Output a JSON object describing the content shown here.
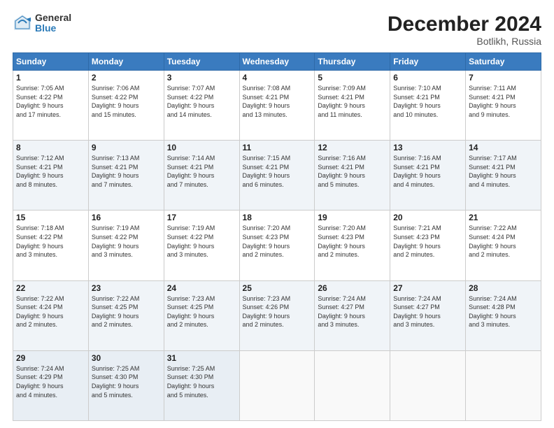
{
  "logo": {
    "line1": "General",
    "line2": "Blue"
  },
  "title": "December 2024",
  "subtitle": "Botlikh, Russia",
  "days_header": [
    "Sunday",
    "Monday",
    "Tuesday",
    "Wednesday",
    "Thursday",
    "Friday",
    "Saturday"
  ],
  "weeks": [
    [
      {
        "day": "1",
        "info": "Sunrise: 7:05 AM\nSunset: 4:22 PM\nDaylight: 9 hours\nand 17 minutes."
      },
      {
        "day": "2",
        "info": "Sunrise: 7:06 AM\nSunset: 4:22 PM\nDaylight: 9 hours\nand 15 minutes."
      },
      {
        "day": "3",
        "info": "Sunrise: 7:07 AM\nSunset: 4:22 PM\nDaylight: 9 hours\nand 14 minutes."
      },
      {
        "day": "4",
        "info": "Sunrise: 7:08 AM\nSunset: 4:21 PM\nDaylight: 9 hours\nand 13 minutes."
      },
      {
        "day": "5",
        "info": "Sunrise: 7:09 AM\nSunset: 4:21 PM\nDaylight: 9 hours\nand 11 minutes."
      },
      {
        "day": "6",
        "info": "Sunrise: 7:10 AM\nSunset: 4:21 PM\nDaylight: 9 hours\nand 10 minutes."
      },
      {
        "day": "7",
        "info": "Sunrise: 7:11 AM\nSunset: 4:21 PM\nDaylight: 9 hours\nand 9 minutes."
      }
    ],
    [
      {
        "day": "8",
        "info": "Sunrise: 7:12 AM\nSunset: 4:21 PM\nDaylight: 9 hours\nand 8 minutes."
      },
      {
        "day": "9",
        "info": "Sunrise: 7:13 AM\nSunset: 4:21 PM\nDaylight: 9 hours\nand 7 minutes."
      },
      {
        "day": "10",
        "info": "Sunrise: 7:14 AM\nSunset: 4:21 PM\nDaylight: 9 hours\nand 7 minutes."
      },
      {
        "day": "11",
        "info": "Sunrise: 7:15 AM\nSunset: 4:21 PM\nDaylight: 9 hours\nand 6 minutes."
      },
      {
        "day": "12",
        "info": "Sunrise: 7:16 AM\nSunset: 4:21 PM\nDaylight: 9 hours\nand 5 minutes."
      },
      {
        "day": "13",
        "info": "Sunrise: 7:16 AM\nSunset: 4:21 PM\nDaylight: 9 hours\nand 4 minutes."
      },
      {
        "day": "14",
        "info": "Sunrise: 7:17 AM\nSunset: 4:21 PM\nDaylight: 9 hours\nand 4 minutes."
      }
    ],
    [
      {
        "day": "15",
        "info": "Sunrise: 7:18 AM\nSunset: 4:22 PM\nDaylight: 9 hours\nand 3 minutes."
      },
      {
        "day": "16",
        "info": "Sunrise: 7:19 AM\nSunset: 4:22 PM\nDaylight: 9 hours\nand 3 minutes."
      },
      {
        "day": "17",
        "info": "Sunrise: 7:19 AM\nSunset: 4:22 PM\nDaylight: 9 hours\nand 3 minutes."
      },
      {
        "day": "18",
        "info": "Sunrise: 7:20 AM\nSunset: 4:23 PM\nDaylight: 9 hours\nand 2 minutes."
      },
      {
        "day": "19",
        "info": "Sunrise: 7:20 AM\nSunset: 4:23 PM\nDaylight: 9 hours\nand 2 minutes."
      },
      {
        "day": "20",
        "info": "Sunrise: 7:21 AM\nSunset: 4:23 PM\nDaylight: 9 hours\nand 2 minutes."
      },
      {
        "day": "21",
        "info": "Sunrise: 7:22 AM\nSunset: 4:24 PM\nDaylight: 9 hours\nand 2 minutes."
      }
    ],
    [
      {
        "day": "22",
        "info": "Sunrise: 7:22 AM\nSunset: 4:24 PM\nDaylight: 9 hours\nand 2 minutes."
      },
      {
        "day": "23",
        "info": "Sunrise: 7:22 AM\nSunset: 4:25 PM\nDaylight: 9 hours\nand 2 minutes."
      },
      {
        "day": "24",
        "info": "Sunrise: 7:23 AM\nSunset: 4:25 PM\nDaylight: 9 hours\nand 2 minutes."
      },
      {
        "day": "25",
        "info": "Sunrise: 7:23 AM\nSunset: 4:26 PM\nDaylight: 9 hours\nand 2 minutes."
      },
      {
        "day": "26",
        "info": "Sunrise: 7:24 AM\nSunset: 4:27 PM\nDaylight: 9 hours\nand 3 minutes."
      },
      {
        "day": "27",
        "info": "Sunrise: 7:24 AM\nSunset: 4:27 PM\nDaylight: 9 hours\nand 3 minutes."
      },
      {
        "day": "28",
        "info": "Sunrise: 7:24 AM\nSunset: 4:28 PM\nDaylight: 9 hours\nand 3 minutes."
      }
    ],
    [
      {
        "day": "29",
        "info": "Sunrise: 7:24 AM\nSunset: 4:29 PM\nDaylight: 9 hours\nand 4 minutes."
      },
      {
        "day": "30",
        "info": "Sunrise: 7:25 AM\nSunset: 4:30 PM\nDaylight: 9 hours\nand 5 minutes."
      },
      {
        "day": "31",
        "info": "Sunrise: 7:25 AM\nSunset: 4:30 PM\nDaylight: 9 hours\nand 5 minutes."
      },
      null,
      null,
      null,
      null
    ]
  ]
}
